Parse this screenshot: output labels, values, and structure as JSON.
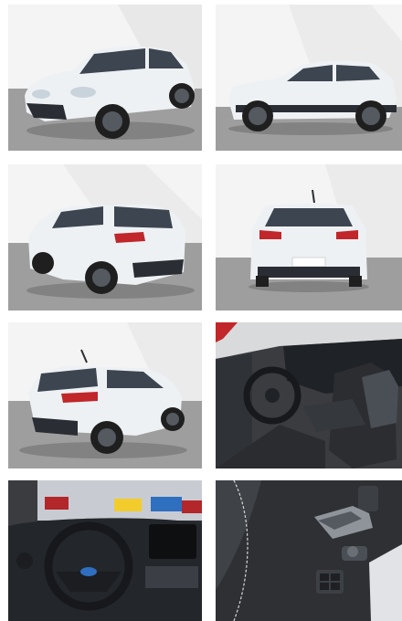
{
  "gallery": {
    "photos": [
      {
        "view": "front-three-quarter"
      },
      {
        "view": "side-profile"
      },
      {
        "view": "rear-three-quarter-left"
      },
      {
        "view": "rear"
      },
      {
        "view": "rear-three-quarter-right"
      },
      {
        "view": "interior-front-seats"
      },
      {
        "view": "dashboard-steering-wheel"
      },
      {
        "view": "door-panel-controls"
      }
    ]
  },
  "colors": {
    "car_body": "#eef1f4",
    "studio_wall": "#f2f2f2",
    "studio_floor": "#9b9b9b",
    "tyre": "#1f1f1f",
    "taillight": "#c0262a",
    "interior_dark": "#2b2d31"
  }
}
